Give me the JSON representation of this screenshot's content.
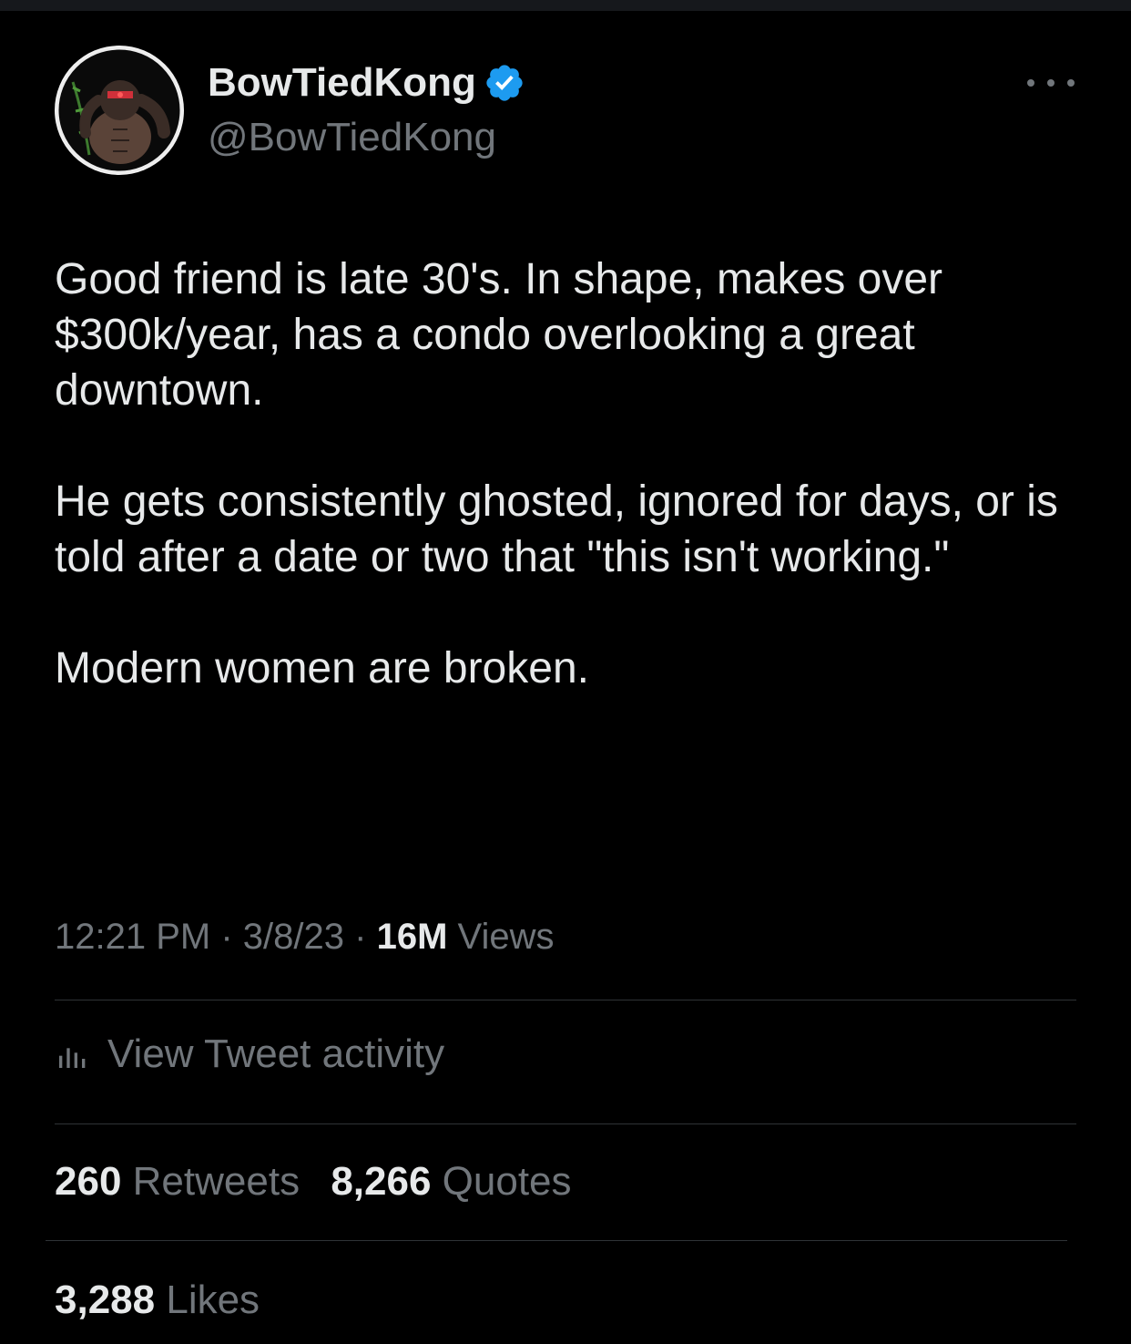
{
  "author": {
    "display_name": "BowTiedKong",
    "handle": "@BowTiedKong",
    "verified": true,
    "avatar_icon": "gorilla-avatar"
  },
  "tweet": {
    "paragraphs": [
      "Good friend is late 30's. In shape, makes over $300k/year, has a condo overlooking a great downtown.",
      "He gets consistently ghosted, ignored for days, or is told after a date or two that \"this isn't working.\"",
      "Modern women are broken."
    ]
  },
  "meta": {
    "time": "12:21 PM",
    "date": "3/8/23",
    "views_count": "16M",
    "views_label": "Views",
    "separator": "·"
  },
  "activity": {
    "label": "View Tweet activity",
    "icon": "bar-chart-icon"
  },
  "stats": {
    "retweets_count": "260",
    "retweets_label": "Retweets",
    "quotes_count": "8,266",
    "quotes_label": "Quotes",
    "likes_count": "3,288",
    "likes_label": "Likes"
  },
  "colors": {
    "background": "#000000",
    "text_primary": "#e7e9ea",
    "text_secondary": "#71767b",
    "divider": "#2f3336",
    "verified_blue": "#1d9bf0"
  }
}
